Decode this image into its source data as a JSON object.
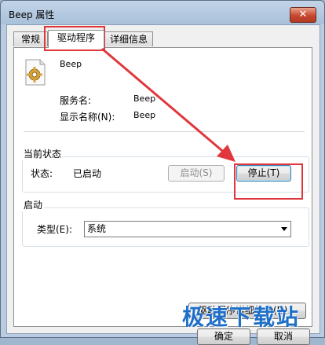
{
  "window": {
    "title": "Beep 属性",
    "close_label": "✕"
  },
  "tabs": [
    {
      "label": "常规"
    },
    {
      "label": "驱动程序"
    },
    {
      "label": "详细信息"
    }
  ],
  "service": {
    "icon": "gear-icon",
    "name": "Beep",
    "service_name_label": "服务名:",
    "service_name_value": "Beep",
    "display_name_label": "显示名称(N):",
    "display_name_value": "Beep"
  },
  "status_group": {
    "title": "当前状态",
    "status_label": "状态:",
    "status_value": "已启动",
    "start_button": "启动(S)",
    "stop_button": "停止(T)"
  },
  "startup_group": {
    "title": "启动",
    "type_label": "类型(E):",
    "type_value": "系统"
  },
  "driver_details_button": "驱动程序详细信息(D)...",
  "footer": {
    "ok_button": "确定",
    "cancel_button": "取消"
  },
  "watermark": {
    "text": "极速下载站"
  },
  "colors": {
    "highlight": "#e0373d",
    "watermark": "#1e6fc8"
  }
}
